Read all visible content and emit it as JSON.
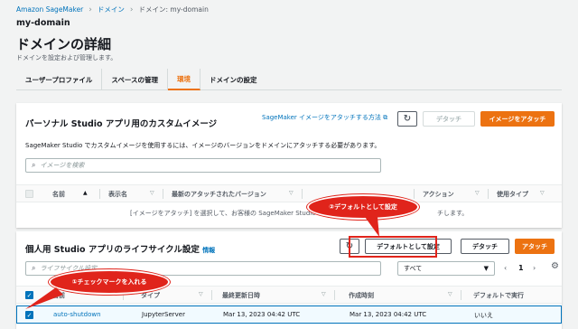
{
  "breadcrumbs": [
    "Amazon SageMaker",
    "ドメイン",
    "ドメイン: my-domain"
  ],
  "domain_name": "my-domain",
  "page_title": "ドメインの詳細",
  "page_desc": "ドメインを設定および管理します。",
  "tabs": [
    "ユーザープロファイル",
    "スペースの管理",
    "環境",
    "ドメインの設定"
  ],
  "images_panel": {
    "title": "パーソナル Studio アプリ用のカスタムイメージ",
    "help_link": "SageMaker イメージをアタッチする方法",
    "detach": "デタッチ",
    "attach": "イメージをアタッチ",
    "desc": "SageMaker Studio でカスタムイメージを使用するには、イメージのバージョンをドメインにアタッチする必要があります。",
    "search_placeholder": "イメージを検索",
    "columns": [
      "名前",
      "表示名",
      "最新のアタッチされたバージョン",
      "",
      "アクション",
      "使用タイプ"
    ],
    "empty_left": "[イメージをアタッチ] を選択して、お客様の SageMaker Studio",
    "empty_right": "チします。"
  },
  "lifecycle_panel": {
    "title": "個人用 Studio アプリのライフサイクル設定",
    "info": "情報",
    "set_default": "デフォルトとして設定",
    "detach": "デタッチ",
    "attach": "アタッチ",
    "search_placeholder": "ライフサイクル設定",
    "filter_value": "すべて",
    "page": "1",
    "columns": [
      "名前",
      "タイプ",
      "最終更新日時",
      "作成時刻",
      "デフォルトで実行"
    ],
    "rows": [
      {
        "name": "auto-shutdown",
        "type": "JupyterServer",
        "updated": "Mar 13, 2023 04:42 UTC",
        "created": "Mar 13, 2023 04:42 UTC",
        "default": "いいえ"
      }
    ]
  },
  "callouts": {
    "set_default": "②デフォルトとして設定",
    "checkmark": "①チェックマークを入れる"
  },
  "colors": {
    "accent": "#ec7211",
    "link": "#0073bb",
    "annotation": "#e0241b"
  }
}
